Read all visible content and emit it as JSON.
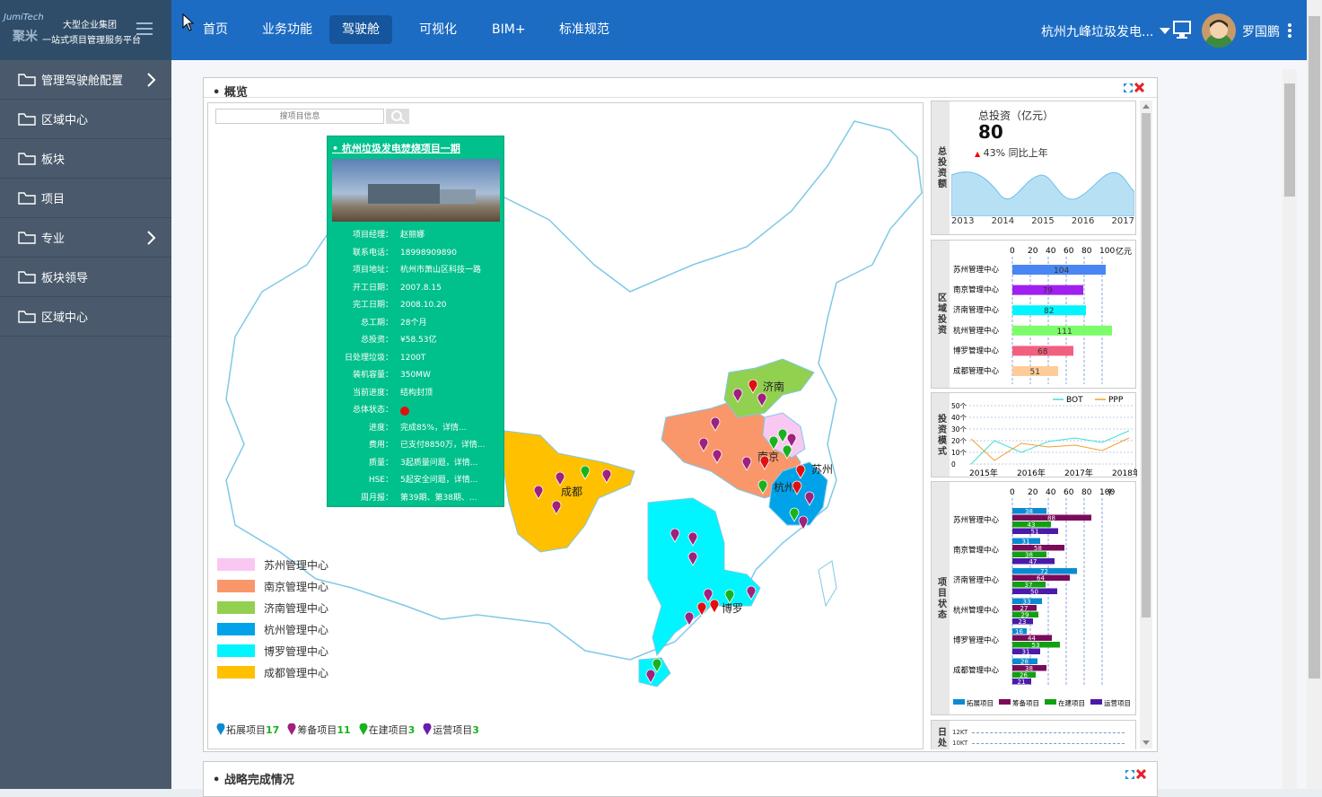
{
  "brand": {
    "logo_text": "JumiTech",
    "logo_cn": "聚米",
    "line1": "大型企业集团",
    "line2": "一站式项目管理服务平台"
  },
  "nav": [
    "首页",
    "业务功能",
    "驾驶舱",
    "可视化",
    "BIM+",
    "标准规范"
  ],
  "nav_active": "驾驶舱",
  "header": {
    "project_select": "杭州九峰垃圾发电...",
    "user_name": "罗国鹏"
  },
  "sidebar": [
    {
      "label": "管理驾驶舱配置",
      "arrow": true
    },
    {
      "label": "区域中心",
      "arrow": false
    },
    {
      "label": "板块",
      "arrow": false
    },
    {
      "label": "项目",
      "arrow": false
    },
    {
      "label": "专业",
      "arrow": true
    },
    {
      "label": "板块领导",
      "arrow": false
    },
    {
      "label": "区域中心",
      "arrow": false
    }
  ],
  "overview": {
    "title": "概览",
    "search_placeholder": "搜项目信息"
  },
  "strategy": {
    "title": "战略完成情况"
  },
  "popup": {
    "title": "杭州垃圾发电焚烧项目一期",
    "fields": [
      {
        "k": "项目经理：",
        "v": "赵丽娜"
      },
      {
        "k": "联系电话：",
        "v": "18998909890"
      },
      {
        "k": "项目地址：",
        "v": "杭州市萧山区科技一路"
      },
      {
        "k": "开工日期：",
        "v": "2007.8.15"
      },
      {
        "k": "完工日期：",
        "v": "2008.10.20"
      },
      {
        "k": "总工期：",
        "v": "28个月"
      },
      {
        "k": "总投资：",
        "v": "¥58.53亿"
      },
      {
        "k": "日处理垃圾：",
        "v": "1200T"
      },
      {
        "k": "装机容量：",
        "v": "350MW"
      },
      {
        "k": "当前进度：",
        "v": "结构封顶"
      },
      {
        "k": "总体状态：",
        "v": ""
      },
      {
        "k": "进度：",
        "v": "完成85%，详情..."
      },
      {
        "k": "费用：",
        "v": "已支付8850万，详情..."
      },
      {
        "k": "质量：",
        "v": "3起质量问题，详情..."
      },
      {
        "k": "HSE：",
        "v": "5起安全问题，详情..."
      },
      {
        "k": "周月报：",
        "v": "第39期、第38期、..."
      }
    ]
  },
  "map": {
    "cities": [
      "济南",
      "南京",
      "苏州",
      "杭州",
      "成都",
      "博罗"
    ],
    "legend": [
      {
        "name": "苏州管理中心",
        "color": "#f9c8f2"
      },
      {
        "name": "南京管理中心",
        "color": "#f9976b"
      },
      {
        "name": "济南管理中心",
        "color": "#92d050"
      },
      {
        "name": "杭州管理中心",
        "color": "#00a2e8"
      },
      {
        "name": "博罗管理中心",
        "color": "#00f5ff"
      },
      {
        "name": "成都管理中心",
        "color": "#ffc000"
      }
    ],
    "project_legend": [
      {
        "name": "拓展项目",
        "count": "17",
        "color": "#0a8bd1"
      },
      {
        "name": "筹备项目",
        "count": "11",
        "color": "#a0207d"
      },
      {
        "name": "在建项目",
        "count": "3",
        "color": "#19b21e"
      },
      {
        "name": "运营项目",
        "count": "3",
        "color": "#6a1bb0"
      }
    ]
  },
  "kpi": {
    "label": "总投资额",
    "title": "总投资（亿元）",
    "value": "80",
    "change": "43% 同比上年",
    "years": [
      "2013",
      "2014",
      "2015",
      "2016",
      "2017"
    ]
  },
  "region": {
    "label": "区域投资",
    "unit": "亿元",
    "ticks": [
      "0",
      "20",
      "40",
      "60",
      "80",
      "100"
    ],
    "rows": [
      {
        "name": "苏州管理中心",
        "value": 104,
        "color": "#4a86f3"
      },
      {
        "name": "南京管理中心",
        "value": 79,
        "color": "#a020f0"
      },
      {
        "name": "济南管理中心",
        "value": 82,
        "color": "#00f5ff"
      },
      {
        "name": "杭州管理中心",
        "value": 111,
        "color": "#7cfc6b"
      },
      {
        "name": "博罗管理中心",
        "value": 68,
        "color": "#f2607f"
      },
      {
        "name": "成都管理中心",
        "value": 51,
        "color": "#ffcc99"
      }
    ]
  },
  "mode": {
    "label": "投资模式",
    "series": [
      {
        "name": "BOT",
        "color": "#40e0d0"
      },
      {
        "name": "PPP",
        "color": "#f0a030"
      }
    ],
    "yticks": [
      "50个",
      "40个",
      "30个",
      "20个",
      "10个",
      "0"
    ],
    "xticks": [
      "2015年",
      "2016年",
      "2017年",
      "2018年"
    ]
  },
  "status": {
    "label": "项目状态",
    "unit": "个",
    "ticks": [
      "0",
      "20",
      "40",
      "60",
      "80",
      "100"
    ],
    "rows": [
      {
        "name": "苏州管理中心",
        "vals": [
          38,
          88,
          43,
          51
        ]
      },
      {
        "name": "南京管理中心",
        "vals": [
          31,
          58,
          38,
          47
        ]
      },
      {
        "name": "济南管理中心",
        "vals": [
          72,
          64,
          37,
          50
        ]
      },
      {
        "name": "杭州管理中心",
        "vals": [
          33,
          27,
          29,
          23
        ]
      },
      {
        "name": "博罗管理中心",
        "vals": [
          16,
          44,
          53,
          31
        ]
      },
      {
        "name": "成都管理中心",
        "vals": [
          28,
          38,
          26,
          21
        ]
      }
    ],
    "series": [
      {
        "name": "拓展项目",
        "color": "#0a8bd1"
      },
      {
        "name": "筹备项目",
        "color": "#7a0a5a"
      },
      {
        "name": "在建项目",
        "color": "#12a012"
      },
      {
        "name": "运营项目",
        "color": "#4b1aa8"
      }
    ]
  },
  "daily": {
    "label": "日处",
    "ticks": [
      "12KT",
      "10KT"
    ]
  }
}
